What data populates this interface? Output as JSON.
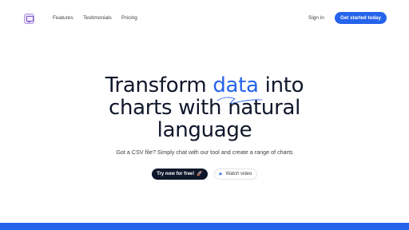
{
  "nav": {
    "links": [
      "Features",
      "Testimonials",
      "Pricing"
    ],
    "signin_label": "Sign in",
    "cta_label": "Get started today"
  },
  "hero": {
    "headline_part1": "Transform ",
    "headline_accent": "data",
    "headline_part2": " into",
    "headline_line2": "charts with natural",
    "headline_line3": "language",
    "subtitle": "Got a CSV file? Simply chat with our tool and create a range of charts",
    "primary_label": "Try now for free!",
    "primary_icon": "🚀",
    "secondary_label": "Watch video",
    "secondary_icon": "▶"
  },
  "colors": {
    "accent": "#2563eb",
    "dark": "#0f172a",
    "text": "#3f3f46"
  },
  "icons": {
    "logo": "monitor-logo-icon",
    "rocket": "rocket-icon",
    "play": "play-icon"
  }
}
